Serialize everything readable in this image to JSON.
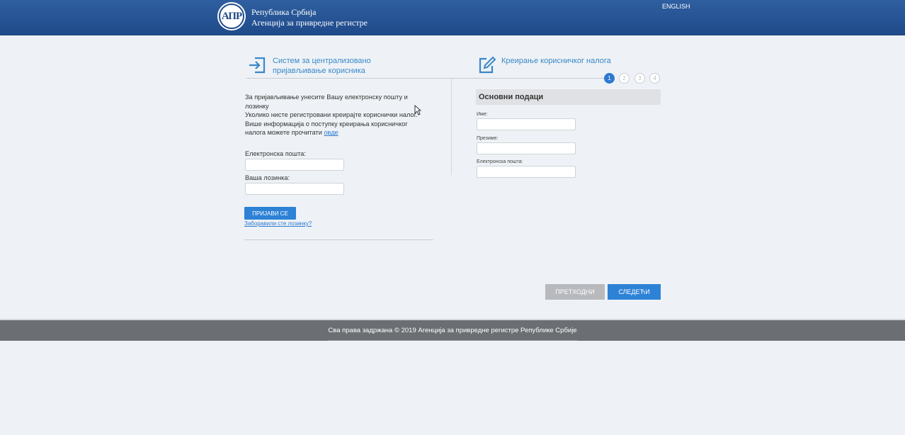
{
  "header": {
    "logo_text": "АПР",
    "brand_line1": "Република Србија",
    "brand_line2": "Агенција за привредне регистре",
    "language_link": "ENGLISH"
  },
  "login_section": {
    "icon": "sign-in-icon",
    "title_line1": "Систем за централизовано",
    "title_line2": "пријављивање корисника",
    "info_line1": "За пријављивање унесите Вашу електронску пошту и",
    "info_line2": "лозинку",
    "info_line3": "Уколико нисте регистровани креирајте кориснички налог.",
    "info_line4": "Више информација о поступку креирања корисничког",
    "info_line5": "налога можете прочитати ",
    "info_link": "овде",
    "email_label": "Електронска пошта:",
    "email_value": "",
    "password_label": "Ваша лозинка:",
    "password_value": "",
    "login_button": "ПРИЈАВИ СЕ",
    "forgot_link": "Заборавили сте лозинку?"
  },
  "register_section": {
    "icon": "edit-icon",
    "title": "Креирање корисничког налога",
    "steps": [
      "1",
      "2",
      "3",
      "4"
    ],
    "active_step": 1,
    "panel_title": "Основни подаци",
    "first_name_label": "Име:",
    "first_name_value": "",
    "last_name_label": "Презиме:",
    "last_name_value": "",
    "email_label": "Електронска пошта:",
    "email_value": "",
    "prev_button": "ПРЕТХОДНИ",
    "next_button": "СЛЕДЕЋИ"
  },
  "footer": {
    "text": "Сва права задржана © 2019 Агенција за привредне регистре Републике Србије"
  },
  "colors": {
    "header": "#1f4a8a",
    "accent": "#2d82d6",
    "background": "#eef2f6",
    "footer": "#6b6e72"
  }
}
